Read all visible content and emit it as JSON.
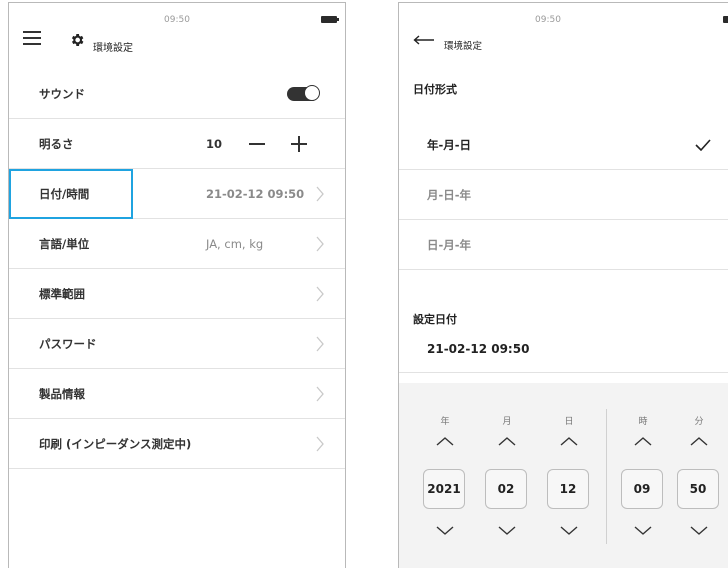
{
  "left": {
    "status_time": "09:50",
    "header_title": "環境設定",
    "rows": [
      {
        "label": "サウンド"
      },
      {
        "label": "明るさ",
        "value": "10"
      },
      {
        "label": "日付/時間",
        "value": "21-02-12 09:50"
      },
      {
        "label": "言語/単位",
        "value": "JA, cm, kg"
      },
      {
        "label": "標準範囲"
      },
      {
        "label": "パスワード"
      },
      {
        "label": "製品情報"
      },
      {
        "label": "印刷 (インピーダンス測定中)"
      }
    ],
    "sound_on": true,
    "highlight_color": "#1fa3e0"
  },
  "right": {
    "status_time": "09:50",
    "back_title": "環境設定",
    "format_title": "日付形式",
    "formats": [
      {
        "label": "年-月-日",
        "selected": true
      },
      {
        "label": "月-日-年",
        "selected": false
      },
      {
        "label": "日-月-年",
        "selected": false
      }
    ],
    "set_date_title": "設定日付",
    "set_date_value": "21-02-12 09:50",
    "picker": {
      "columns": [
        {
          "header": "年",
          "value": "2021"
        },
        {
          "header": "月",
          "value": "02"
        },
        {
          "header": "日",
          "value": "12"
        },
        {
          "header": "時",
          "value": "09"
        },
        {
          "header": "分",
          "value": "50"
        }
      ]
    }
  }
}
